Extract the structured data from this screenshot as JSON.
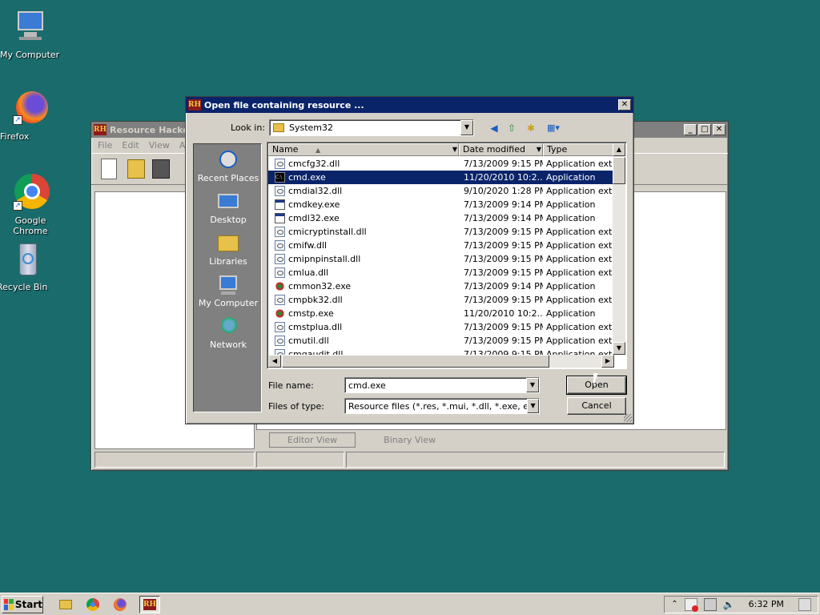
{
  "desktop": {
    "icons": [
      {
        "label": "My Computer",
        "icon": "computer-icon"
      },
      {
        "label": "Firefox",
        "icon": "firefox-icon"
      },
      {
        "label": "Google Chrome",
        "icon": "chrome-icon"
      },
      {
        "label": "Recycle Bin",
        "icon": "recycle-bin-icon"
      }
    ]
  },
  "rh_window": {
    "title": "Resource Hacker",
    "menu": [
      "File",
      "Edit",
      "View",
      "Act"
    ],
    "tabs": [
      "Editor View",
      "Binary View"
    ]
  },
  "dialog": {
    "title": "Open file containing resource ...",
    "look_in_label": "Look in:",
    "look_in_value": "System32",
    "places": [
      {
        "label": "Recent Places",
        "icon": "recent-places-icon"
      },
      {
        "label": "Desktop",
        "icon": "desktop-icon"
      },
      {
        "label": "Libraries",
        "icon": "libraries-icon"
      },
      {
        "label": "My Computer",
        "icon": "computer-icon"
      },
      {
        "label": "Network",
        "icon": "network-icon"
      }
    ],
    "columns": [
      "Name",
      "Date modified",
      "Type"
    ],
    "files": [
      {
        "name": "cmcfg32.dll",
        "date": "7/13/2009 9:15 PM",
        "type": "Application exte...",
        "icon": "dll"
      },
      {
        "name": "cmd.exe",
        "date": "11/20/2010 10:2...",
        "type": "Application",
        "icon": "cmd",
        "selected": true
      },
      {
        "name": "cmdial32.dll",
        "date": "9/10/2020 1:28 PM",
        "type": "Application exte...",
        "icon": "dll"
      },
      {
        "name": "cmdkey.exe",
        "date": "7/13/2009 9:14 PM",
        "type": "Application",
        "icon": "exe"
      },
      {
        "name": "cmdl32.exe",
        "date": "7/13/2009 9:14 PM",
        "type": "Application",
        "icon": "exe"
      },
      {
        "name": "cmicryptinstall.dll",
        "date": "7/13/2009 9:15 PM",
        "type": "Application exte...",
        "icon": "dll"
      },
      {
        "name": "cmifw.dll",
        "date": "7/13/2009 9:15 PM",
        "type": "Application exte...",
        "icon": "dll"
      },
      {
        "name": "cmipnpinstall.dll",
        "date": "7/13/2009 9:15 PM",
        "type": "Application exte...",
        "icon": "dll"
      },
      {
        "name": "cmlua.dll",
        "date": "7/13/2009 9:15 PM",
        "type": "Application exte...",
        "icon": "dll"
      },
      {
        "name": "cmmon32.exe",
        "date": "7/13/2009 9:14 PM",
        "type": "Application",
        "icon": "gear"
      },
      {
        "name": "cmpbk32.dll",
        "date": "7/13/2009 9:15 PM",
        "type": "Application exte...",
        "icon": "dll"
      },
      {
        "name": "cmstp.exe",
        "date": "11/20/2010 10:2...",
        "type": "Application",
        "icon": "gear"
      },
      {
        "name": "cmstplua.dll",
        "date": "7/13/2009 9:15 PM",
        "type": "Application exte...",
        "icon": "dll"
      },
      {
        "name": "cmutil.dll",
        "date": "7/13/2009 9:15 PM",
        "type": "Application exte...",
        "icon": "dll"
      },
      {
        "name": "cmgaudit.dll",
        "date": "7/13/2009 9:15 PM",
        "type": "Application exte...",
        "icon": "dll"
      }
    ],
    "file_name_label": "File name:",
    "file_name_value": "cmd.exe",
    "file_type_label": "Files of type:",
    "file_type_value": "Resource files (*.res, *.mui, *.dll, *.exe, etc.)",
    "open_label": "Open",
    "cancel_label": "Cancel"
  },
  "taskbar": {
    "start_label": "Start",
    "clock": "6:32 PM"
  },
  "colors": {
    "desktop": "#1a6b6b",
    "title_active": "#0a246a",
    "selection": "#0a246a"
  }
}
